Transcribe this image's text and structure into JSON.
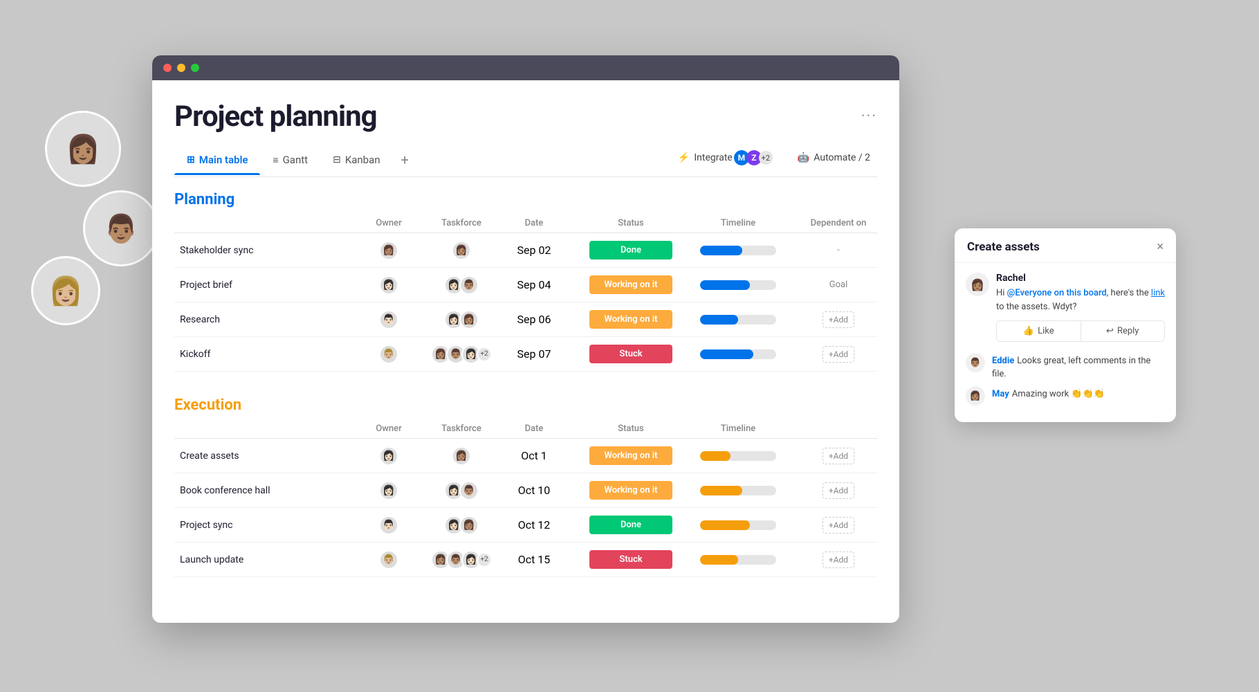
{
  "window": {
    "title": "Project planning",
    "tabs": [
      {
        "id": "main-table",
        "label": "Main table",
        "icon": "⊞",
        "active": true
      },
      {
        "id": "gantt",
        "label": "Gantt",
        "icon": "≡",
        "active": false
      },
      {
        "id": "kanban",
        "label": "Kanban",
        "icon": "⊟",
        "active": false
      }
    ],
    "toolbar": {
      "integrate_label": "Integrate",
      "automate_label": "Automate / 2"
    }
  },
  "planning_section": {
    "title": "Planning",
    "columns": [
      "",
      "Owner",
      "Taskforce",
      "Date",
      "Status",
      "Timeline",
      "Dependent on"
    ],
    "rows": [
      {
        "name": "Stakeholder sync",
        "date": "Sep 02",
        "status": "Done",
        "status_type": "done",
        "timeline_pct": 55,
        "dep": "-"
      },
      {
        "name": "Project brief",
        "date": "Sep 04",
        "status": "Working on it",
        "status_type": "working",
        "timeline_pct": 65,
        "dep": "Goal"
      },
      {
        "name": "Research",
        "date": "Sep 06",
        "status": "Working on it",
        "status_type": "working",
        "timeline_pct": 50,
        "dep": "+Add"
      },
      {
        "name": "Kickoff",
        "date": "Sep 07",
        "status": "Stuck",
        "status_type": "stuck",
        "timeline_pct": 70,
        "dep": "+Add"
      }
    ]
  },
  "execution_section": {
    "title": "Execution",
    "columns": [
      "",
      "Owner",
      "Taskforce",
      "Date",
      "Status",
      "Timeline",
      ""
    ],
    "rows": [
      {
        "name": "Create assets",
        "date": "Oct 1",
        "status": "Working on it",
        "status_type": "working",
        "timeline_pct": 40,
        "dep": "+Add"
      },
      {
        "name": "Book conference hall",
        "date": "Oct 10",
        "status": "Working on it",
        "status_type": "working",
        "timeline_pct": 55,
        "dep": "+Add"
      },
      {
        "name": "Project sync",
        "date": "Oct 12",
        "status": "Done",
        "status_type": "done",
        "timeline_pct": 65,
        "dep": "+Add"
      },
      {
        "name": "Launch update",
        "date": "Oct 15",
        "status": "Stuck",
        "status_type": "stuck",
        "timeline_pct": 50,
        "dep": "+Add"
      }
    ]
  },
  "comment_panel": {
    "title": "Create assets",
    "close": "×",
    "author": "Rachel",
    "message_pre": "Hi ",
    "mention": "@Everyone on this board",
    "message_mid": ", here's the ",
    "link": "link",
    "message_post": " to the assets. Wdyt?",
    "like_label": "Like",
    "reply_label": "Reply",
    "replies": [
      {
        "author": "Eddie",
        "text": "Looks great, left comments in the file."
      },
      {
        "author": "May",
        "text": "Amazing work 👏👏👏"
      }
    ]
  },
  "dots_menu": "···"
}
